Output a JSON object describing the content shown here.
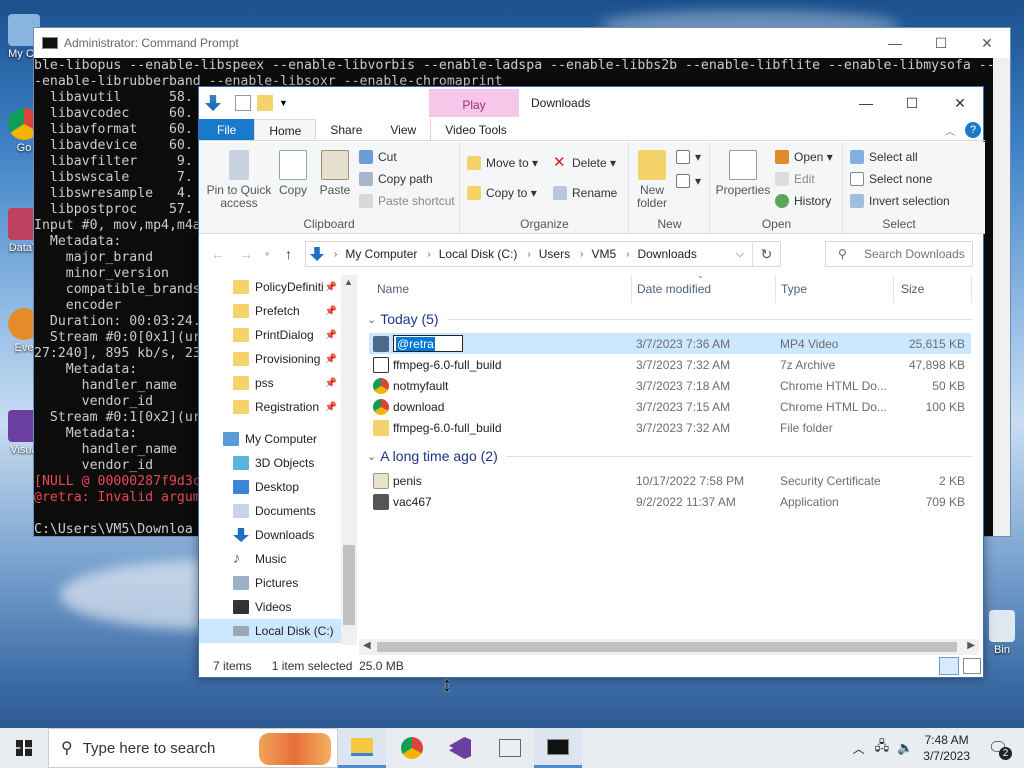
{
  "desktop": {
    "icons": [
      {
        "label": "My Co"
      },
      {
        "label": "Go"
      },
      {
        "label": "DataV"
      },
      {
        "label": "Eve"
      },
      {
        "label": "Visua"
      }
    ],
    "recycle_label": "Bin"
  },
  "cmd": {
    "title": "Administrator: Command Prompt",
    "lines": [
      "ble-libopus --enable-libspeex --enable-libvorbis --enable-ladspa --enable-libbs2b --enable-libflite --enable-libmysofa --",
      "-enable-librubberband --enable-libsoxr --enable-chromaprint",
      "  libavutil      58.",
      "  libavcodec     60.",
      "  libavformat    60.",
      "  libavdevice    60.",
      "  libavfilter     9.",
      "  libswscale      7.",
      "  libswresample   4.",
      "  libpostproc    57.",
      "Input #0, mov,mp4,m4a",
      "  Metadata:",
      "    major_brand     ",
      "    minor_version   ",
      "    compatible_brands",
      "    encoder         ",
      "  Duration: 00:03:24.",
      "  Stream #0:0[0x1](ur",
      "27:240], 895 kb/s, 23",
      "    Metadata:",
      "      handler_name    ",
      "      vendor_id       ",
      "  Stream #0:1[0x2](ur",
      "    Metadata:",
      "      handler_name    ",
      "      vendor_id       ",
      "[NULL @ 00000287f9d3c",
      "@retra: Invalid argum",
      "",
      "C:\\Users\\VM5\\Downloa"
    ]
  },
  "explorer": {
    "title": "Downloads",
    "context_tab": "Play",
    "tabs": [
      "File",
      "Home",
      "Share",
      "View",
      "Video Tools"
    ],
    "ribbon": {
      "clipboard": {
        "pin": "Pin to Quick access",
        "copy": "Copy",
        "paste": "Paste",
        "cut": "Cut",
        "copy_path": "Copy path",
        "paste_shortcut": "Paste shortcut",
        "label": "Clipboard"
      },
      "organize": {
        "move_to": "Move to",
        "copy_to": "Copy to",
        "delete": "Delete",
        "rename": "Rename",
        "label": "Organize"
      },
      "new": {
        "new_folder": "New folder",
        "label": "New"
      },
      "open": {
        "properties": "Properties",
        "open": "Open",
        "edit": "Edit",
        "history": "History",
        "label": "Open"
      },
      "select": {
        "select_all": "Select all",
        "select_none": "Select none",
        "invert": "Invert selection",
        "label": "Select"
      }
    },
    "address": {
      "crumbs": [
        "My Computer",
        "Local Disk (C:)",
        "Users",
        "VM5",
        "Downloads"
      ],
      "search_placeholder": "Search Downloads"
    },
    "nav": [
      {
        "label": "PolicyDefiniti",
        "pinned": true
      },
      {
        "label": "Prefetch",
        "pinned": true
      },
      {
        "label": "PrintDialog",
        "pinned": true
      },
      {
        "label": "Provisioning",
        "pinned": true
      },
      {
        "label": "pss",
        "pinned": true
      },
      {
        "label": "Registration",
        "pinned": true
      },
      {
        "label": "My Computer"
      },
      {
        "label": "3D Objects"
      },
      {
        "label": "Desktop"
      },
      {
        "label": "Documents"
      },
      {
        "label": "Downloads"
      },
      {
        "label": "Music"
      },
      {
        "label": "Pictures"
      },
      {
        "label": "Videos"
      },
      {
        "label": "Local Disk (C:)"
      }
    ],
    "columns": [
      "Name",
      "Date modified",
      "Type",
      "Size"
    ],
    "groups": [
      {
        "label": "Today (5)",
        "files": [
          {
            "name": "@retra",
            "rename_text": "@retra",
            "date": "3/7/2023 7:36 AM",
            "type": "MP4 Video",
            "size": "25,615 KB"
          },
          {
            "name": "ffmpeg-6.0-full_build",
            "date": "3/7/2023 7:32 AM",
            "type": "7z Archive",
            "size": "47,898 KB"
          },
          {
            "name": "notmyfault",
            "date": "3/7/2023 7:18 AM",
            "type": "Chrome HTML Do...",
            "size": "50 KB"
          },
          {
            "name": "download",
            "date": "3/7/2023 7:15 AM",
            "type": "Chrome HTML Do...",
            "size": "100 KB"
          },
          {
            "name": "ffmpeg-6.0-full_build",
            "date": "3/7/2023 7:32 AM",
            "type": "File folder",
            "size": ""
          }
        ]
      },
      {
        "label": "A long time ago (2)",
        "files": [
          {
            "name": "penis",
            "date": "10/17/2022 7:58 PM",
            "type": "Security Certificate",
            "size": "2 KB"
          },
          {
            "name": "vac467",
            "date": "9/2/2022 11:37 AM",
            "type": "Application",
            "size": "709 KB"
          }
        ]
      }
    ],
    "status": {
      "items": "7 items",
      "selected": "1 item selected  25.0 MB"
    }
  },
  "taskbar": {
    "search_placeholder": "Type here to search",
    "time": "7:48 AM",
    "date": "3/7/2023",
    "notifications": "2"
  }
}
